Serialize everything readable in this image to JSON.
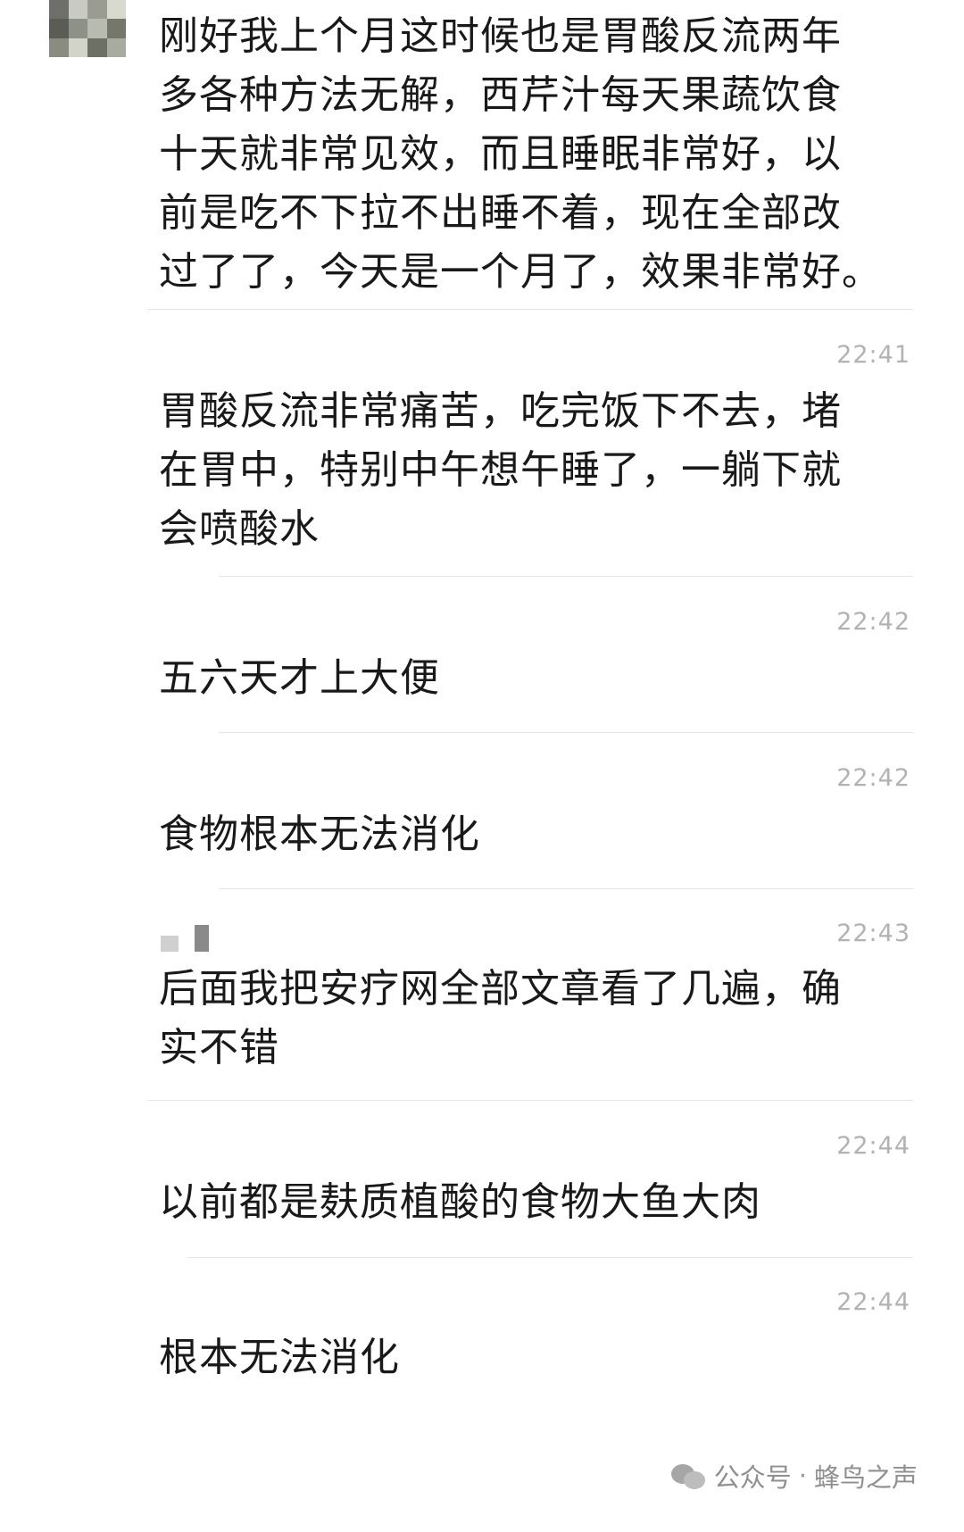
{
  "messages": [
    {
      "text": "刚好我上个月这时候也是胃酸反流两年\n多各种方法无解，西芹汁每天果蔬饮食\n十天就非常见效，而且睡眠非常好，以\n前是吃不下拉不出睡不着，现在全部改\n过了了，今天是一个月了，效果非常好。",
      "time": ""
    },
    {
      "text": "胃酸反流非常痛苦，吃完饭下不去，堵\n在胃中，特别中午想午睡了，一躺下就\n会喷酸水",
      "time": "22:41"
    },
    {
      "text": "五六天才上大便",
      "time": "22:42"
    },
    {
      "text": "食物根本无法消化",
      "time": "22:42"
    },
    {
      "text": "后面我把安疗网全部文章看了几遍，确\n实不错",
      "time": "22:43"
    },
    {
      "text": "以前都是麸质植酸的食物大鱼大肉",
      "time": "22:44"
    },
    {
      "text": "根本无法消化",
      "time": "22:44"
    }
  ],
  "watermark": {
    "source_label": "公众号",
    "separator": "·",
    "account_name": "蜂鸟之声"
  }
}
